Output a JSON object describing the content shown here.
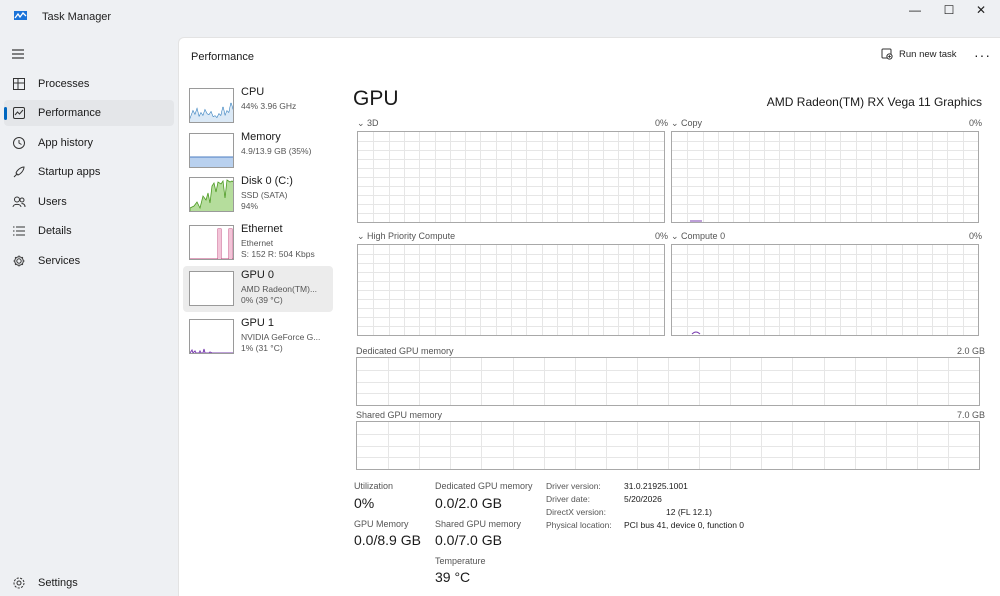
{
  "window": {
    "title": "Task Manager",
    "minimize": "—",
    "maximize": "☐",
    "close": "✕"
  },
  "nav": {
    "items": [
      {
        "label": "Processes",
        "icon": "processes-icon"
      },
      {
        "label": "Performance",
        "icon": "performance-icon",
        "selected": true
      },
      {
        "label": "App history",
        "icon": "app-history-icon"
      },
      {
        "label": "Startup apps",
        "icon": "startup-apps-icon"
      },
      {
        "label": "Users",
        "icon": "users-icon"
      },
      {
        "label": "Details",
        "icon": "details-icon"
      },
      {
        "label": "Services",
        "icon": "services-icon"
      }
    ],
    "settings": "Settings"
  },
  "header": {
    "title": "Performance",
    "run_new_task": "Run new task",
    "more": "···"
  },
  "devices": [
    {
      "name": "CPU",
      "sub1": "44%  3.96 GHz",
      "sub2": "",
      "sub3": "",
      "color": "#1b6fb5"
    },
    {
      "name": "Memory",
      "sub1": "4.9/13.9 GB (35%)",
      "sub2": "",
      "sub3": "",
      "color": "#4a7cc0"
    },
    {
      "name": "Disk 0 (C:)",
      "sub1": "SSD (SATA)",
      "sub2": "94%",
      "sub3": "",
      "color": "#4d9a23"
    },
    {
      "name": "Ethernet",
      "sub1": "Ethernet",
      "sub2": "S: 152  R: 504 Kbps",
      "sub3": "",
      "color": "#c1467b"
    },
    {
      "name": "GPU 0",
      "sub1": "AMD Radeon(TM)...",
      "sub2": "0%  (39 °C)",
      "sub3": "",
      "color": "#7b3fb0",
      "selected": true
    },
    {
      "name": "GPU 1",
      "sub1": "NVIDIA GeForce G...",
      "sub2": "1%  (31 °C)",
      "sub3": "",
      "color": "#7b3fb0"
    }
  ],
  "gpu": {
    "title": "GPU",
    "model": "AMD Radeon(TM) RX Vega 11 Graphics",
    "engines": [
      {
        "name": "3D",
        "value": "0%"
      },
      {
        "name": "Copy",
        "value": "0%"
      },
      {
        "name": "High Priority Compute",
        "value": "0%"
      },
      {
        "name": "Compute 0",
        "value": "0%"
      }
    ],
    "dedicated_label": "Dedicated GPU memory",
    "dedicated_max": "2.0 GB",
    "shared_label": "Shared GPU memory",
    "shared_max": "7.0 GB"
  },
  "stats": {
    "utilization_label": "Utilization",
    "utilization": "0%",
    "dedicated_label": "Dedicated GPU memory",
    "dedicated": "0.0/2.0 GB",
    "gpu_memory_label": "GPU Memory",
    "gpu_memory": "0.0/8.9 GB",
    "shared_label": "Shared GPU memory",
    "shared": "0.0/7.0 GB",
    "temperature_label": "Temperature",
    "temperature": "39 °C"
  },
  "info": [
    {
      "key": "Driver version:",
      "value": "31.0.21925.1001"
    },
    {
      "key": "Driver date:",
      "value": "5/20/2026"
    },
    {
      "key": "DirectX version:",
      "value": "12 (FL 12.1)"
    },
    {
      "key": "Physical location:",
      "value": "PCI bus 41, device 0, function 0"
    }
  ],
  "colors": {
    "accent": "#0067c0",
    "gpu_line": "#7b3fb0",
    "grid": "#e6e6e6"
  }
}
